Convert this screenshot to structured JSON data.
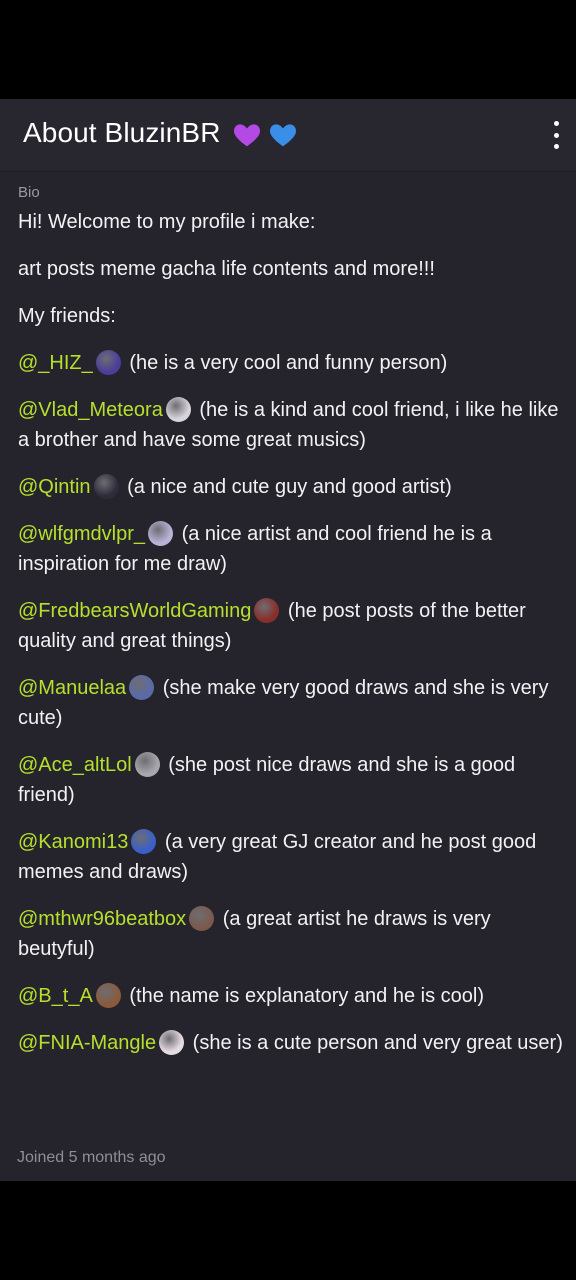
{
  "header": {
    "title": "About BluzinBR",
    "heart_purple_color": "#b44ae6",
    "heart_blue_color": "#3b8ee8",
    "menu_icon": "more-vertical-icon"
  },
  "bio": {
    "label": "Bio",
    "intro_line": "Hi! Welcome to my profile i make:",
    "content_line": "art posts meme gacha life contents and more!!!",
    "friends_heading": "My friends:",
    "friends": [
      {
        "handle": "@_HIZ_",
        "note": "(he is a very cool and funny person)",
        "avatar_color": "#4a3e9a"
      },
      {
        "handle": "@Vlad_Meteora",
        "note": "(he is a kind and cool friend, i like he like a brother and have some great musics)",
        "avatar_color": "#d9d4dc"
      },
      {
        "handle": "@Qintin",
        "note": "(a nice and cute guy and good artist)",
        "avatar_color": "#2e2c3a"
      },
      {
        "handle": "@wlfgmdvlpr_",
        "note": "(a nice artist and cool friend he is a inspiration for me draw)",
        "avatar_color": "#b9b4d6"
      },
      {
        "handle": "@FredbearsWorldGaming",
        "note": "(he post posts of the better quality and great things)",
        "avatar_color": "#8a2e2a"
      },
      {
        "handle": "@Manuelaa",
        "note": "(she make very good draws and she is very cute)",
        "avatar_color": "#5a6aa8"
      },
      {
        "handle": "@Ace_altLol",
        "note": "(she post nice draws and she is a good friend)",
        "avatar_color": "#a8a7ad"
      },
      {
        "handle": "@Kanomi13",
        "note": "(a very great GJ creator and he post good memes and draws)",
        "avatar_color": "#3a5fc8"
      },
      {
        "handle": "@mthwr96beatbox",
        "note": "(a great artist he draws is very beutyful)",
        "avatar_color": "#7a5a4e"
      },
      {
        "handle": "@B_t_A",
        "note": "(the name is explanatory and he is cool)",
        "avatar_color": "#8b5a3a"
      },
      {
        "handle": "@FNIA-Mangle",
        "note": "(she is a cute person and very great user)",
        "avatar_color": "#e6dde2"
      }
    ]
  },
  "footer": {
    "joined_text": "Joined 5 months ago"
  }
}
